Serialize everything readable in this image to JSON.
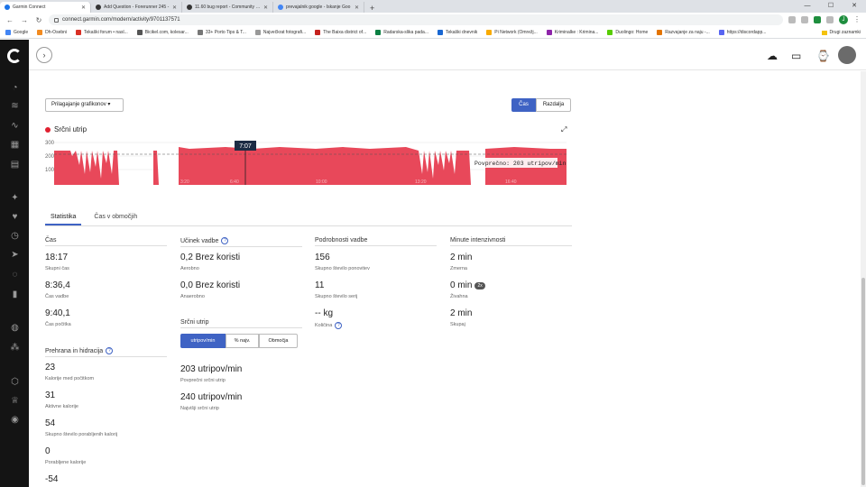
{
  "browser": {
    "tabs": [
      {
        "title": "Garmin Connect",
        "active": true
      },
      {
        "title": "Add Question - Forerunner 245 -",
        "active": false
      },
      {
        "title": "11.60 bug report - Community - G",
        "active": false
      },
      {
        "title": "prevajalnik google - Iskanje Goo",
        "active": false
      }
    ],
    "url": "connect.garmin.com/modern/activity/9701137571",
    "profile_initial": "J",
    "bookmarks": [
      "Google",
      "Dh-Osebni",
      "Tekaški forum • nasl...",
      "Bicikel.com, kolesar...",
      "33+ Porto Tips & T...",
      "Največkrat fotografi...",
      "The Baixa district of...",
      "Radarska-slika pada...",
      "Tekaški dnevnik",
      "Pi Network (Omrežj...",
      "Kriminalke : Krimina...",
      "Duolingo: Home",
      "Razvajanje za naju -...",
      "https://discordapp..."
    ],
    "other_bookmarks": "Drugi zaznamki"
  },
  "toolbar": {
    "chart_customize": "Prilagajanje grafikonov ▾",
    "toggle_time": "Čas",
    "toggle_distance": "Razdalja"
  },
  "hr_chart": {
    "title": "Srčni utrip",
    "ytick_top": "300",
    "ytick_mid": "200",
    "ytick_low": "100",
    "cursor_label": "7:07",
    "avg_label": "Povprečno: 203 utripov/min",
    "xticks": [
      "3:20",
      "6:40",
      "10:00",
      "13:20",
      "16:40"
    ]
  },
  "stats_tabs": {
    "statistics": "Statistika",
    "time_in_zones": "Čas v območjih"
  },
  "time": {
    "title": "Čas",
    "total_value": "18:17",
    "total_label": "Skupni čas",
    "work_value": "8:36,4",
    "work_label": "Čas vadbe",
    "rest_value": "9:40,1",
    "rest_label": "Čas počitka"
  },
  "nutrition": {
    "title": "Prehrana in hidracija",
    "resting_cal_value": "23",
    "resting_cal_label": "Kalorije med počitkom",
    "active_cal_value": "31",
    "active_cal_label": "Aktivne kalorije",
    "total_cal_value": "54",
    "total_cal_label": "Skupno število porabljenih kalorij",
    "consumed_cal_value": "0",
    "consumed_cal_label": "Porabljene kalorije",
    "net_value": "-54"
  },
  "training_effect": {
    "title": "Učinek vadbe",
    "aerobic_value": "0,2 Brez koristi",
    "aerobic_label": "Aerobno",
    "anaerobic_value": "0,0 Brez koristi",
    "anaerobic_label": "Anaerobno"
  },
  "heart_rate": {
    "title": "Srčni utrip",
    "seg_bpm": "utripov/min",
    "seg_percent": "% najv.",
    "seg_zones": "Območja",
    "avg_value": "203 utripov/min",
    "avg_label": "Povprečni srčni utrip",
    "max_value": "240 utripov/min",
    "max_label": "Najvišji srčni utrip"
  },
  "workout_details": {
    "title": "Podrobnosti vadbe",
    "reps_value": "156",
    "reps_label": "Skupno število ponovitev",
    "sets_value": "11",
    "sets_label": "Skupno število serij",
    "volume_value": "-- kg",
    "volume_label": "Količina"
  },
  "intensity": {
    "title": "Minute intenzivnosti",
    "moderate_value": "2 min",
    "moderate_label": "Zmerna",
    "vigorous_value": "0 min",
    "vigorous_badge": "2x",
    "vigorous_label": "Živahna",
    "total_value": "2 min",
    "total_label": "Skupaj"
  },
  "colors": {
    "accent": "#3f63c4",
    "hr_fill": "#e8485a",
    "hr_dot": "#e0202f",
    "sidebar": "#141414"
  },
  "icons": {
    "sidebar": [
      "dashboard-icon",
      "activities-icon",
      "trends-icon",
      "calendar-icon",
      "reports-icon",
      "training-icon",
      "health-icon",
      "timer-icon",
      "gear-icon",
      "insights-icon",
      "stats-icon",
      "connections-icon",
      "groups-icon",
      "badges-icon",
      "challenges-icon",
      "settings-icon"
    ],
    "topbar": [
      "upload-icon",
      "inbox-icon",
      "device-icon"
    ]
  }
}
